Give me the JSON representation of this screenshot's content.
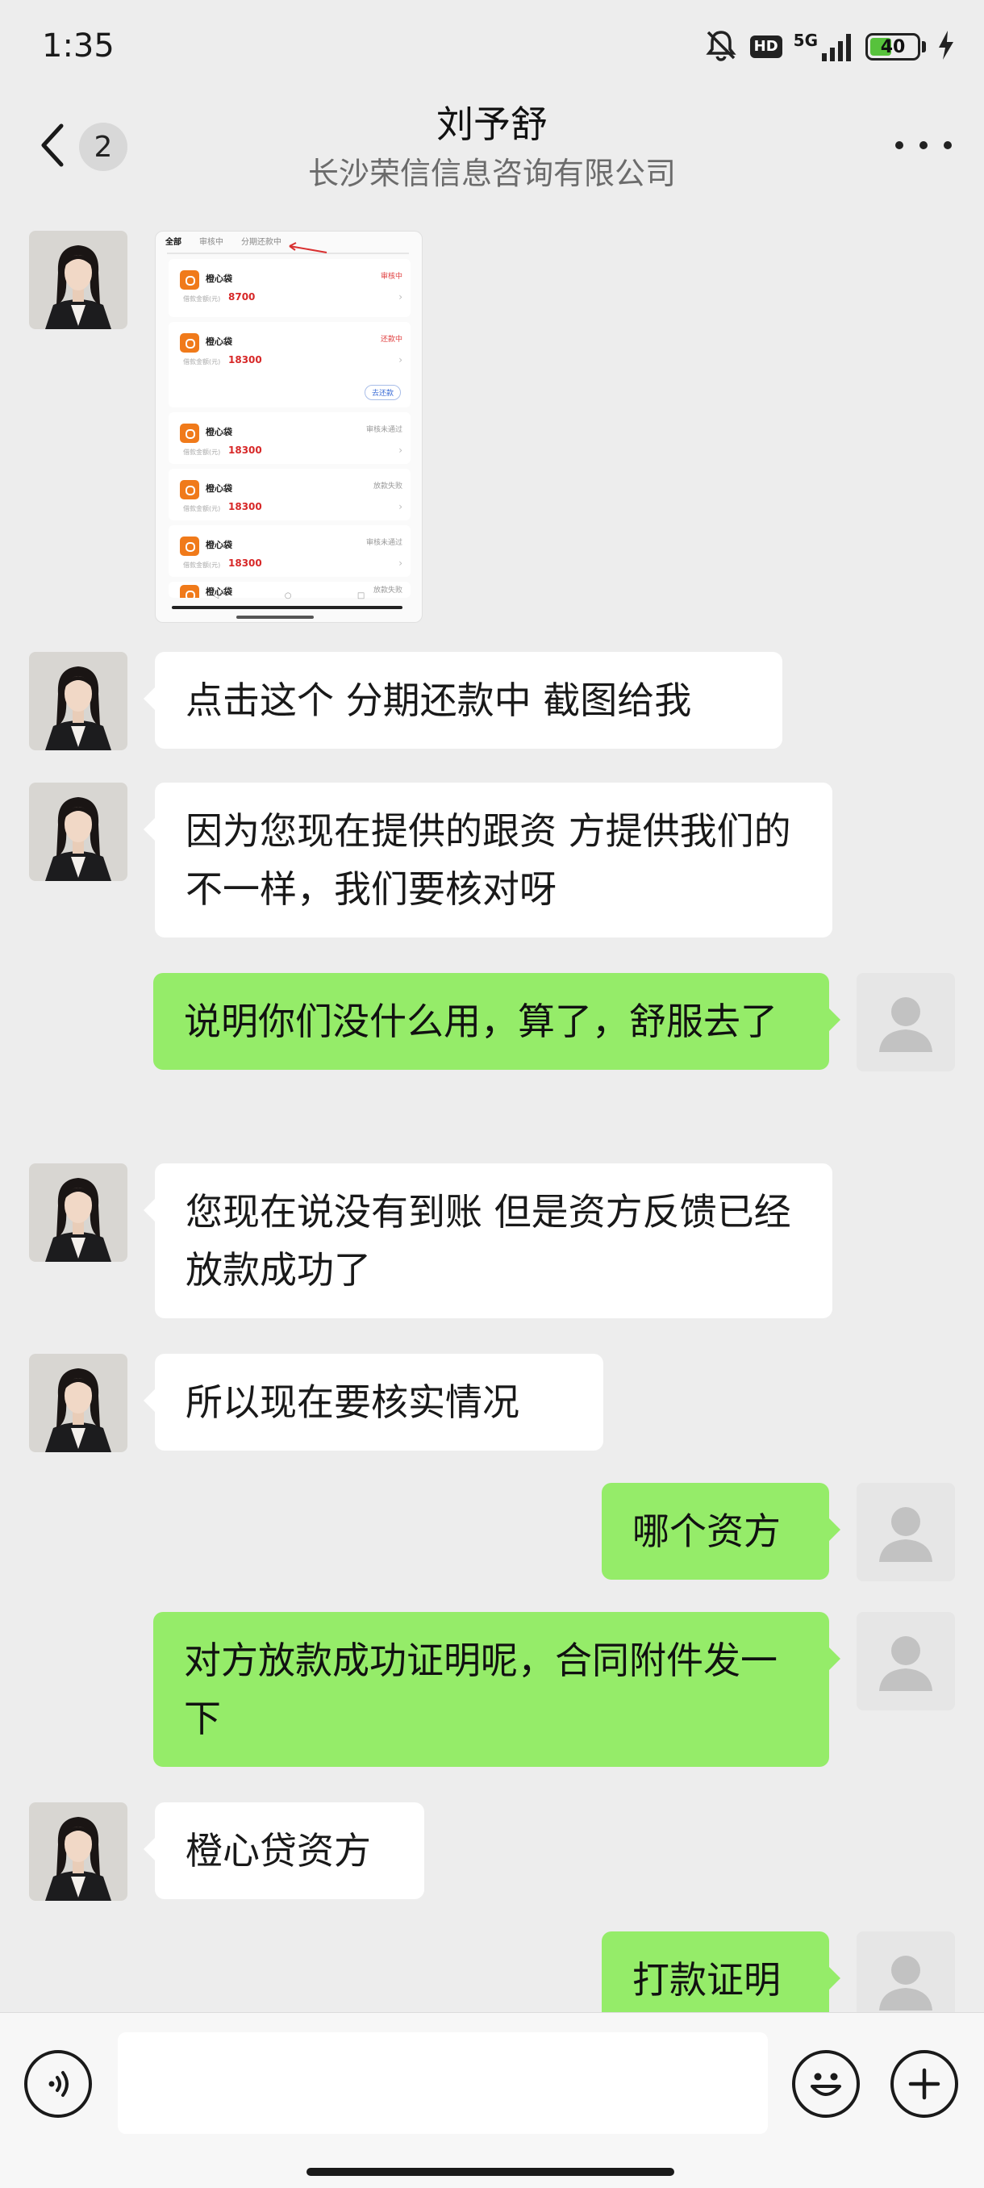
{
  "status_bar": {
    "time": "1:35",
    "hd_label": "HD",
    "network_label": "5G",
    "battery_percent": "40",
    "icons": [
      "mute-bell-icon",
      "hd-icon",
      "signal-icon",
      "battery-icon",
      "charging-icon"
    ]
  },
  "header": {
    "back_icon": "chevron-left-icon",
    "unread_count": "2",
    "title": "刘予舒",
    "subtitle": "长沙荣信信息咨询有限公司",
    "more_icon": "more-dots-icon"
  },
  "image_message": {
    "tabs": [
      "全部",
      "审核中",
      "分期还款中"
    ],
    "cards": [
      {
        "name": "橙心袋",
        "status": "审核中",
        "amount_label": "借款金额(元)",
        "amount": "8700"
      },
      {
        "name": "橙心袋",
        "status": "还款中",
        "amount_label": "借款金额(元)",
        "amount": "18300",
        "button": "去还款"
      },
      {
        "name": "橙心袋",
        "status": "审核未通过",
        "amount_label": "借款金额(元)",
        "amount": "18300"
      },
      {
        "name": "橙心袋",
        "status": "放款失败",
        "amount_label": "借款金额(元)",
        "amount": "18300"
      },
      {
        "name": "橙心袋",
        "status": "审核未通过",
        "amount_label": "借款金额(元)",
        "amount": "18300"
      },
      {
        "name": "橙心袋",
        "status": "放款失败"
      }
    ]
  },
  "messages": [
    {
      "direction": "in",
      "text": "点击这个 分期还款中 截图给我"
    },
    {
      "direction": "in",
      "text": "因为您现在提供的跟资 方提供我们的不一样，我们要核对呀"
    },
    {
      "direction": "out",
      "text": "说明你们没什么用，算了，舒服去了"
    },
    {
      "direction": "in",
      "text": "您现在说没有到账 但是资方反馈已经放款成功了"
    },
    {
      "direction": "in",
      "text": "所以现在要核实情况"
    },
    {
      "direction": "out",
      "text": "哪个资方"
    },
    {
      "direction": "out",
      "text": "对方放款成功证明呢，合同附件发一下"
    },
    {
      "direction": "in",
      "text": "橙心贷资方"
    },
    {
      "direction": "out",
      "text": "打款证明"
    }
  ],
  "input_bar": {
    "voice_icon": "voice-icon",
    "emoji_icon": "emoji-icon",
    "plus_icon": "plus-icon",
    "input_value": ""
  },
  "colors": {
    "background": "#ededed",
    "incoming_bubble": "#ffffff",
    "outgoing_bubble": "#95ec69",
    "battery_fill": "#57c23c"
  }
}
